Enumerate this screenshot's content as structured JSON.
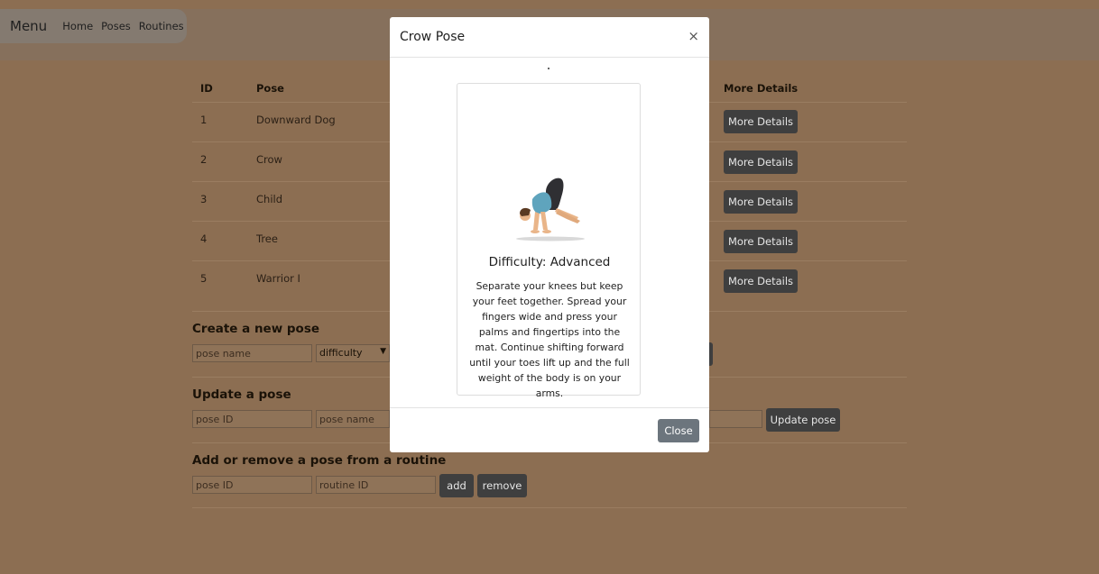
{
  "nav": {
    "title": "Menu",
    "links": [
      "Home",
      "Poses",
      "Routines"
    ]
  },
  "table": {
    "headers": {
      "id": "ID",
      "pose": "Pose",
      "details": "More Details"
    },
    "rows": [
      {
        "id": "1",
        "pose": "Downward Dog",
        "button": "More Details"
      },
      {
        "id": "2",
        "pose": "Crow",
        "button": "More Details"
      },
      {
        "id": "3",
        "pose": "Child",
        "button": "More Details"
      },
      {
        "id": "4",
        "pose": "Tree",
        "button": "More Details"
      },
      {
        "id": "5",
        "pose": "Warrior I",
        "button": "More Details"
      }
    ]
  },
  "create": {
    "title": "Create a new pose",
    "name_placeholder": "pose name",
    "difficulty_value": "difficulty"
  },
  "update": {
    "title": "Update a pose",
    "id_placeholder": "pose ID",
    "name_placeholder": "pose name",
    "button": "Update pose"
  },
  "routine": {
    "title": "Add or remove a pose from a routine",
    "pose_placeholder": "pose ID",
    "routine_placeholder": "routine ID",
    "add_label": "add",
    "remove_label": "remove"
  },
  "modal": {
    "title": "Crow Pose",
    "close_symbol": "×",
    "difficulty": "Difficulty: Advanced",
    "description": "Separate your knees but keep your feet together. Spread your fingers wide and press your palms and fingertips into the mat. Continue shifting forward until your toes lift up and the full weight of the body is on your arms.",
    "image_icon": "crow-pose-illustration",
    "close_label": "Close"
  },
  "colors": {
    "page_background": "#8c6e52",
    "dark_button": "#3f3f3f",
    "close_button": "#6c757d"
  }
}
